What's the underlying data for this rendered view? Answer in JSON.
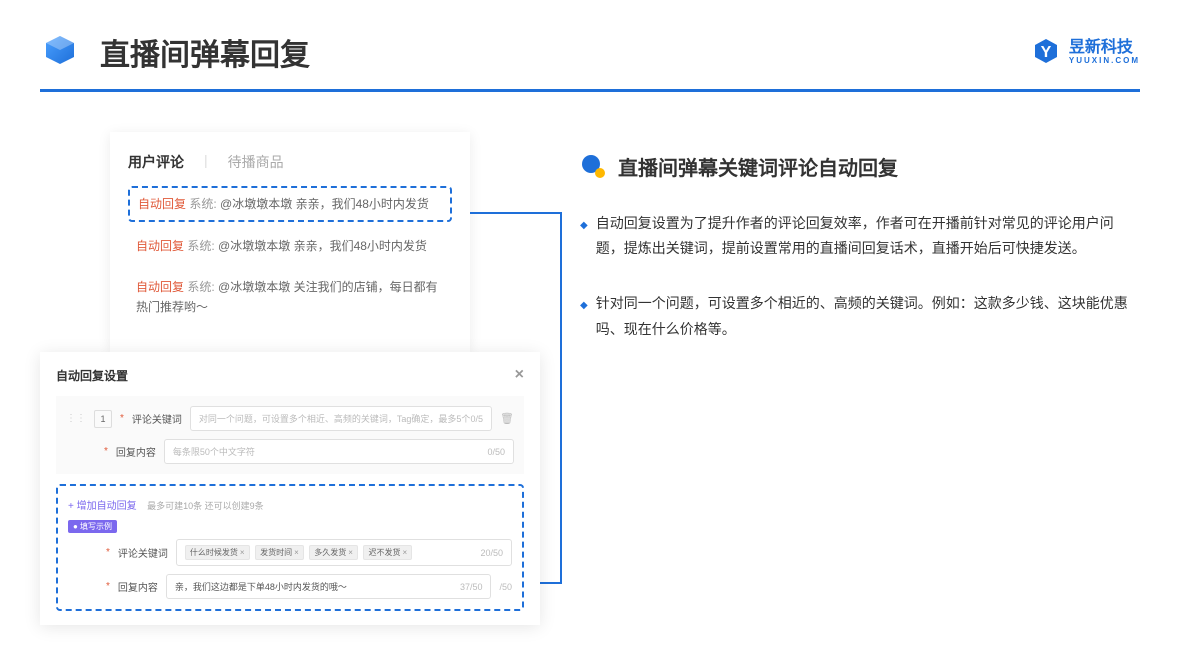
{
  "header": {
    "title": "直播间弹幕回复",
    "brand_name": "昱新科技",
    "brand_sub": "YUUXIN.COM"
  },
  "tabs": {
    "active": "用户评论",
    "inactive": "待播商品"
  },
  "comments": [
    {
      "auto": "自动回复",
      "sys": "系统:",
      "text": "@冰墩墩本墩 亲亲，我们48小时内发货",
      "hl": true
    },
    {
      "auto": "自动回复",
      "sys": "系统:",
      "text": "@冰墩墩本墩 亲亲，我们48小时内发货",
      "hl": false
    },
    {
      "auto": "自动回复",
      "sys": "系统:",
      "text": "@冰墩墩本墩 关注我们的店铺，每日都有热门推荐哟～",
      "hl": false
    }
  ],
  "modal": {
    "title": "自动回复设置",
    "row_num": "1",
    "keyword_label": "评论关键词",
    "keyword_placeholder": "对同一个问题，可设置多个相近、高频的关键词，Tag确定，最多5个",
    "keyword_counter": "0/5",
    "content_label": "回复内容",
    "content_placeholder": "每条限50个中文字符",
    "content_counter": "0/50",
    "add_link": "+ 增加自动回复",
    "add_hint": "最多可建10条 还可以创建9条",
    "example_badge": "● 填写示例",
    "ex_keyword_label": "评论关键词",
    "ex_tags": [
      "什么时候发货",
      "发货时间",
      "多久发货",
      "迟不发货"
    ],
    "ex_keyword_counter": "20/50",
    "ex_content_label": "回复内容",
    "ex_content_value": "亲，我们这边都是下单48小时内发货的哦～",
    "ex_content_counter": "37/50",
    "extra_counter": "/50"
  },
  "right": {
    "section_title": "直播间弹幕关键词评论自动回复",
    "bullets": [
      "自动回复设置为了提升作者的评论回复效率，作者可在开播前针对常见的评论用户问题，提炼出关键词，提前设置常用的直播间回复话术，直播开始后可快捷发送。",
      "针对同一个问题，可设置多个相近的、高频的关键词。例如：这款多少钱、这块能优惠吗、现在什么价格等。"
    ]
  }
}
